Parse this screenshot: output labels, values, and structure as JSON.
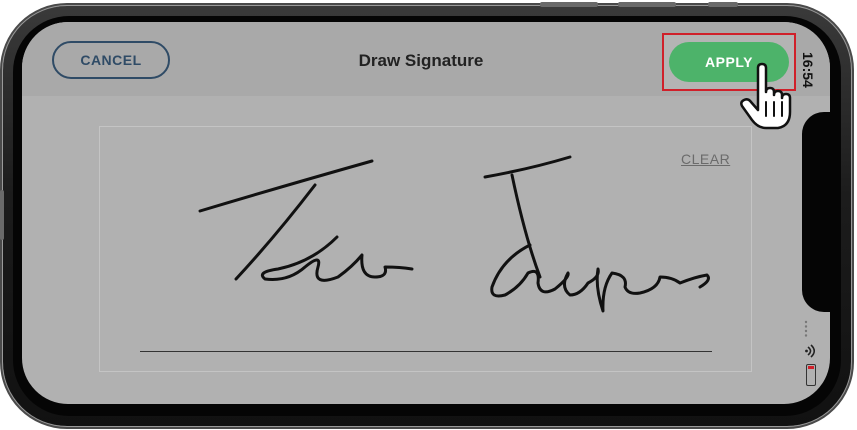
{
  "header": {
    "cancel_label": "CANCEL",
    "title": "Draw Signature",
    "apply_label": "APPLY"
  },
  "status_bar": {
    "time": "16:54"
  },
  "signature_pad": {
    "clear_label": "CLEAR"
  },
  "colors": {
    "apply_green": "#4db36a",
    "cancel_navy": "#2f4b66",
    "highlight_red": "#d0202a",
    "screen_gray": "#b1b1b1"
  },
  "icons": [
    "hand-pointer-icon",
    "wifi-icon",
    "battery-icon"
  ]
}
